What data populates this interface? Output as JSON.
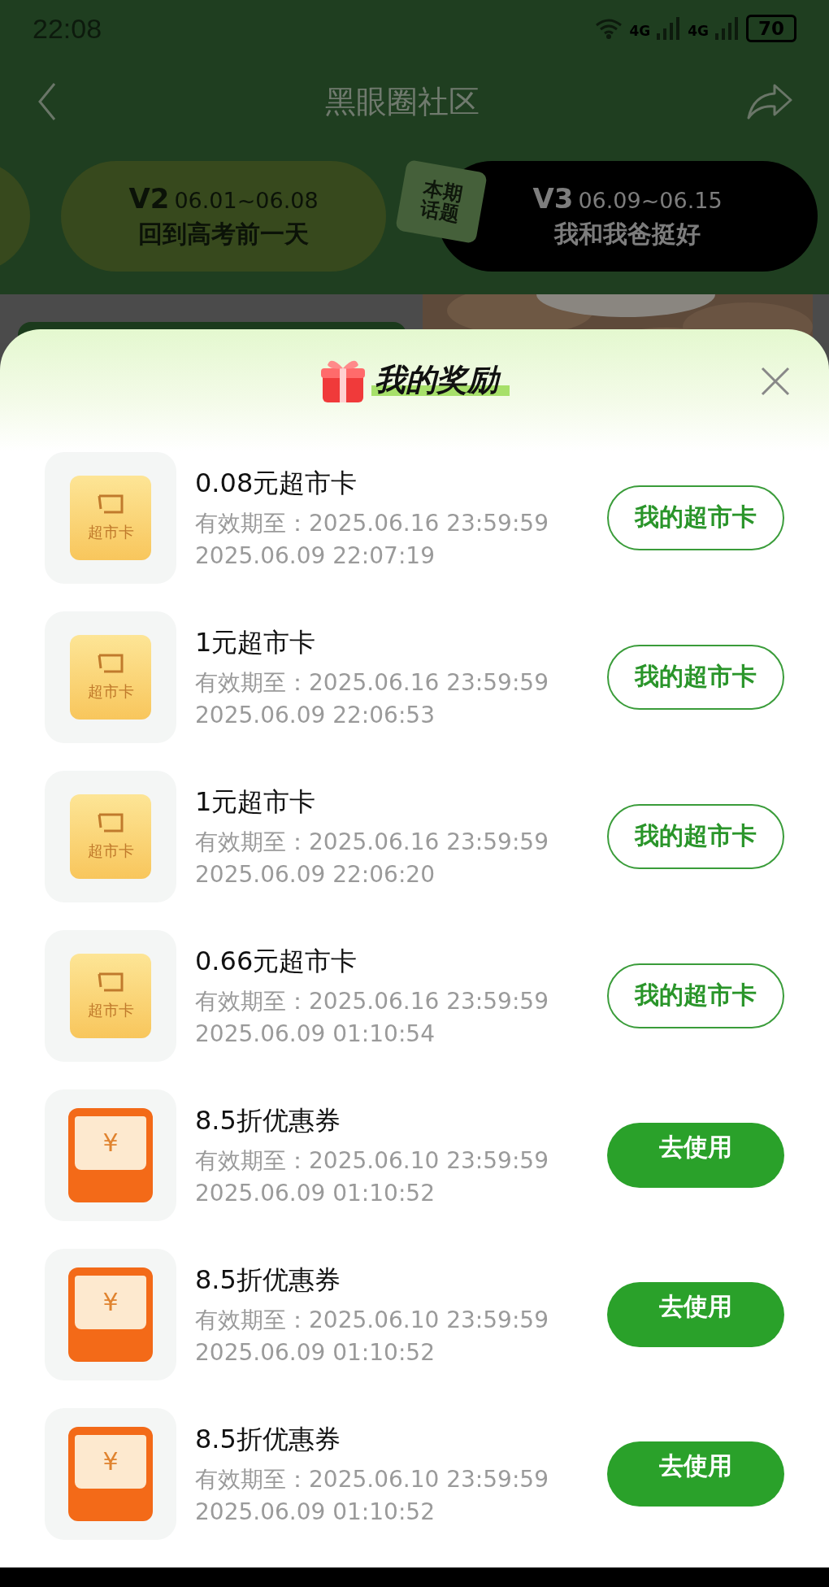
{
  "status_bar": {
    "time": "22:08",
    "network_labels": [
      "4G",
      "4G"
    ],
    "battery": "70"
  },
  "nav": {
    "title": "黑眼圈社区"
  },
  "topics": [
    {
      "version": "V2",
      "dates": "06.01~06.08",
      "title": "回到高考前一天",
      "selected": false
    },
    {
      "version": "V3",
      "dates": "06.09~06.15",
      "title": "我和我爸挺好",
      "selected": true,
      "badge": "本期话题"
    }
  ],
  "rewards_sheet": {
    "title": "我的奖励",
    "items": [
      {
        "kind": "card",
        "icon_label": "超市卡",
        "title": "0.08元超市卡",
        "expiry": "有效期至：2025.06.16 23:59:59",
        "time": "2025.06.09 22:07:19",
        "action": "我的超市卡"
      },
      {
        "kind": "card",
        "icon_label": "超市卡",
        "title": "1元超市卡",
        "expiry": "有效期至：2025.06.16 23:59:59",
        "time": "2025.06.09 22:06:53",
        "action": "我的超市卡"
      },
      {
        "kind": "card",
        "icon_label": "超市卡",
        "title": "1元超市卡",
        "expiry": "有效期至：2025.06.16 23:59:59",
        "time": "2025.06.09 22:06:20",
        "action": "我的超市卡"
      },
      {
        "kind": "card",
        "icon_label": "超市卡",
        "title": "0.66元超市卡",
        "expiry": "有效期至：2025.06.16 23:59:59",
        "time": "2025.06.09 01:10:54",
        "action": "我的超市卡"
      },
      {
        "kind": "coupon",
        "icon_label": "¥",
        "title": "8.5折优惠券",
        "expiry": "有效期至：2025.06.10 23:59:59",
        "time": "2025.06.09 01:10:52",
        "action": "去使用"
      },
      {
        "kind": "coupon",
        "icon_label": "¥",
        "title": "8.5折优惠券",
        "expiry": "有效期至：2025.06.10 23:59:59",
        "time": "2025.06.09 01:10:52",
        "action": "去使用"
      },
      {
        "kind": "coupon",
        "icon_label": "¥",
        "title": "8.5折优惠券",
        "expiry": "有效期至：2025.06.10 23:59:59",
        "time": "2025.06.09 01:10:52",
        "action": "去使用"
      }
    ]
  }
}
